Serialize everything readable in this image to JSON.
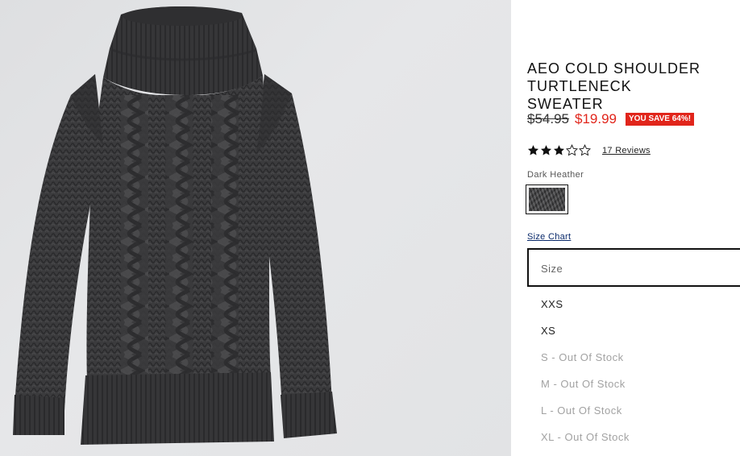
{
  "product": {
    "title": "AEO COLD SHOULDER TURTLENECK\nSWEATER",
    "image_alt": "Dark heather cable knit cold shoulder turtleneck sweater"
  },
  "price": {
    "original": "$54.95",
    "sale": "$19.99",
    "save_badge": "YOU SAVE 64%!"
  },
  "rating": {
    "stars": 3,
    "max_stars": 5,
    "reviews_label": "17 Reviews"
  },
  "color": {
    "label": "Dark Heather",
    "swatch_color": "#3d3d3f"
  },
  "size": {
    "chart_link": "Size Chart",
    "select_placeholder": "Size",
    "options": [
      {
        "label": "XXS",
        "in_stock": true
      },
      {
        "label": "XS",
        "in_stock": true
      },
      {
        "label": "S - Out Of Stock",
        "in_stock": false
      },
      {
        "label": "M - Out Of Stock",
        "in_stock": false
      },
      {
        "label": "L - Out Of Stock",
        "in_stock": false
      },
      {
        "label": "XL - Out Of Stock",
        "in_stock": false
      }
    ]
  },
  "colors": {
    "sale_red": "#e1251b",
    "out_of_stock_gray": "#a2a2a2",
    "background_gray": "#e3e4e6"
  }
}
